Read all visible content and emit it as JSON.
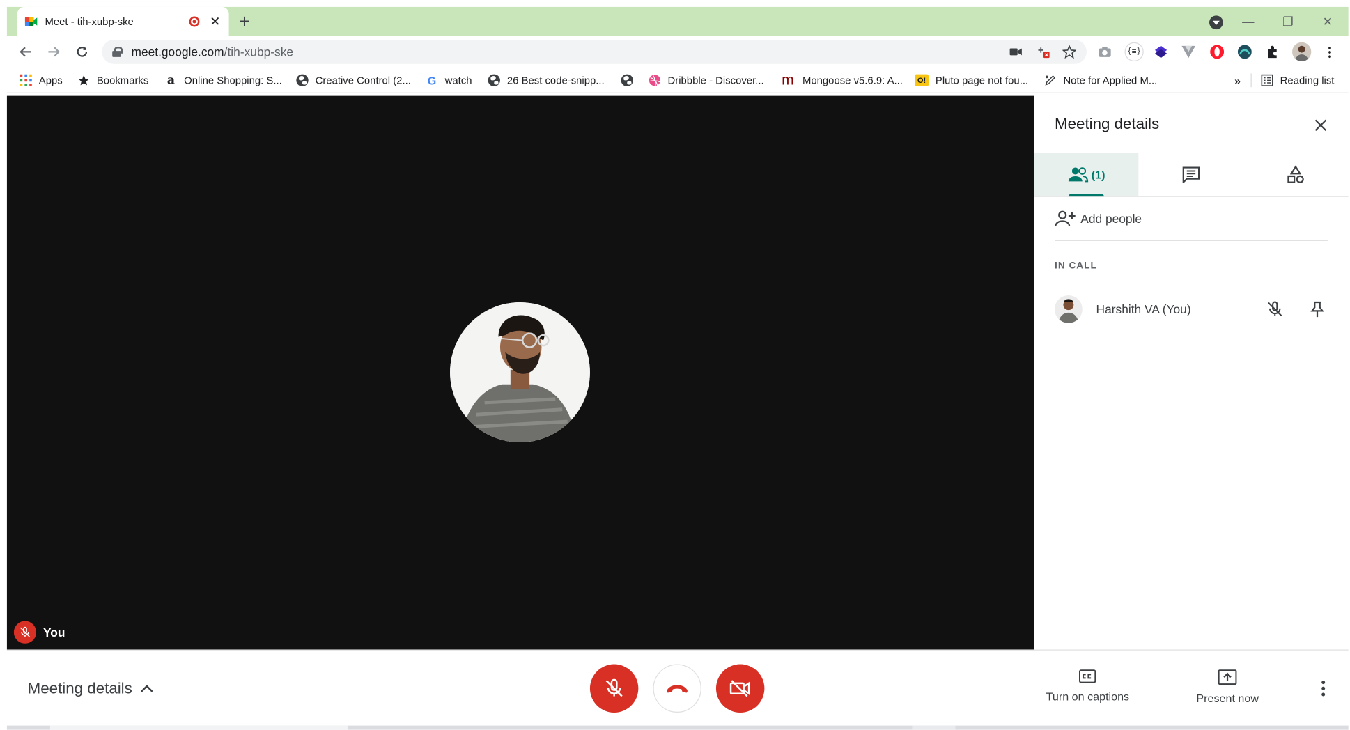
{
  "browser": {
    "tab_title": "Meet - tih-xubp-ske",
    "url_host": "meet.google.com",
    "url_path": "/tih-xubp-ske",
    "tabstrip_color": "#c8e6b9"
  },
  "bookmarks": {
    "items": [
      {
        "label": "Apps",
        "icon": "apps-grid-icon"
      },
      {
        "label": "Bookmarks",
        "icon": "star-icon"
      },
      {
        "label": "Online Shopping: S...",
        "icon": "amazon-icon"
      },
      {
        "label": "Creative Control (2...",
        "icon": "globe-icon"
      },
      {
        "label": "watch",
        "icon": "google-icon"
      },
      {
        "label": "26 Best code-snipp...",
        "icon": "globe-icon"
      },
      {
        "label": "",
        "icon": "globe-icon"
      },
      {
        "label": "Dribbble - Discover...",
        "icon": "dribbble-icon"
      },
      {
        "label": "Mongoose v5.6.9: A...",
        "icon": "mongoose-icon"
      },
      {
        "label": "Pluto page not fou...",
        "icon": "pluto-icon"
      },
      {
        "label": "Note for Applied M...",
        "icon": "note-icon"
      }
    ],
    "overflow": "»",
    "reading_list": "Reading list"
  },
  "video": {
    "self_label": "You"
  },
  "panel": {
    "title": "Meeting details",
    "people_count": "(1)",
    "add_people": "Add people",
    "section_label": "IN CALL",
    "participants": [
      {
        "name": "Harshith VA (You)"
      }
    ]
  },
  "bottom": {
    "meeting_details": "Meeting details",
    "captions": "Turn on captions",
    "present": "Present now"
  },
  "colors": {
    "accent": "#00796b",
    "danger": "#d93025",
    "video_bg": "#111111"
  }
}
